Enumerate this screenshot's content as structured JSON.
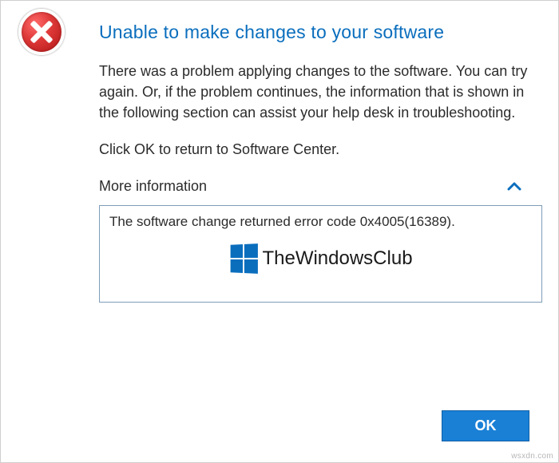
{
  "dialog": {
    "title": "Unable to make changes to your software",
    "body": "There was a problem applying changes to the software.  You can try again. Or, if the problem continues, the information that is shown in the following section can assist your help desk in troubleshooting.",
    "subtext": "Click OK to return to Software Center.",
    "more_info_label": "More information",
    "error_detail": "The software change returned error code 0x4005(16389).",
    "ok_label": "OK"
  },
  "watermark": {
    "text": "TheWindowsClub"
  },
  "corner": "wsxdn.com"
}
